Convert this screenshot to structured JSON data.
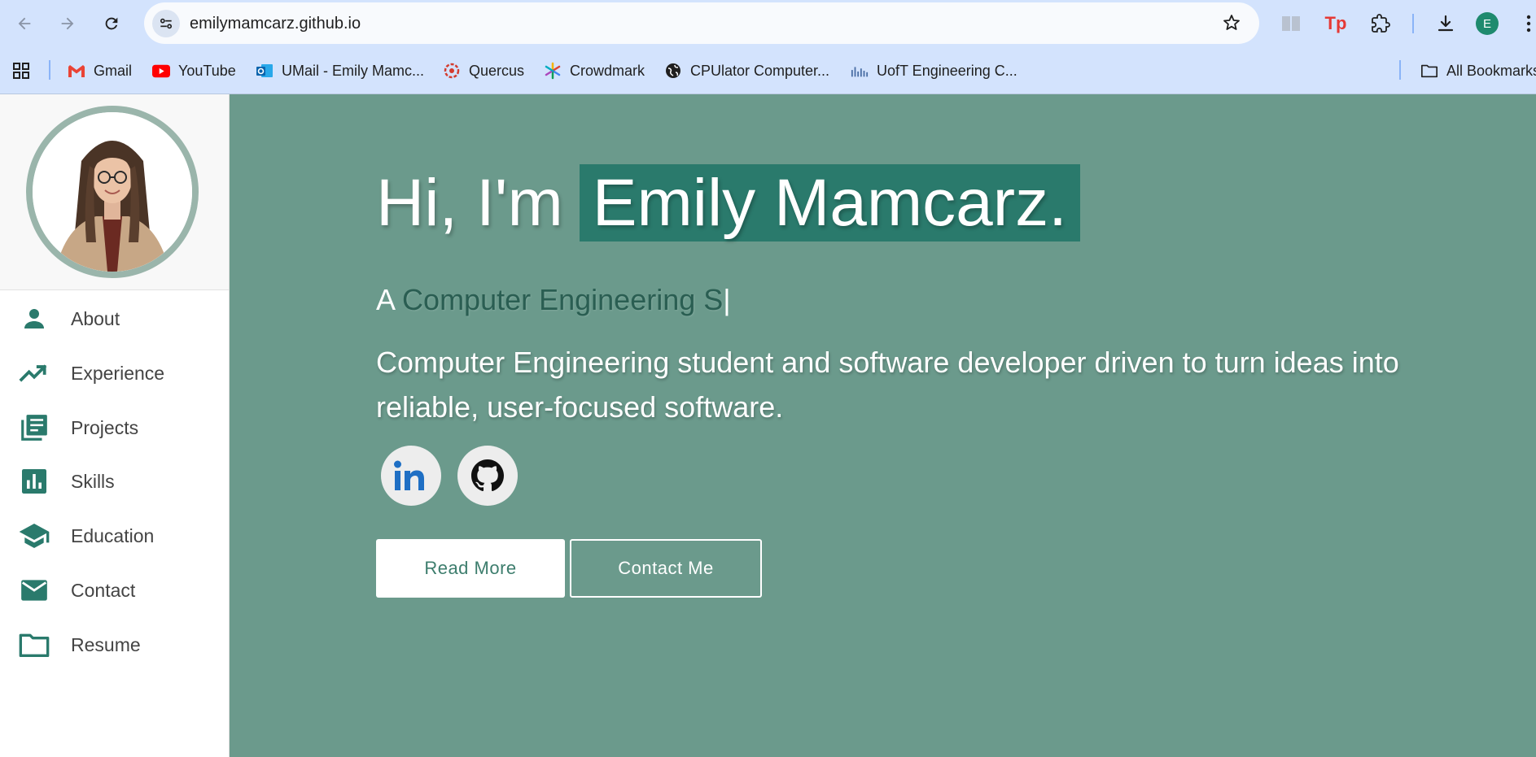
{
  "browser": {
    "url": "emilymamcarz.github.io",
    "profile_initial": "E",
    "bookmarks": [
      {
        "label": "Gmail",
        "icon": "gmail-icon"
      },
      {
        "label": "YouTube",
        "icon": "youtube-icon"
      },
      {
        "label": "UMail - Emily Mamc...",
        "icon": "outlook-icon"
      },
      {
        "label": "Quercus",
        "icon": "quercus-icon"
      },
      {
        "label": "Crowdmark",
        "icon": "crowdmark-icon"
      },
      {
        "label": "CPUlator Computer...",
        "icon": "globe-icon"
      },
      {
        "label": "UofT Engineering C...",
        "icon": "uoft-icon"
      }
    ],
    "all_bookmarks": "All Bookmarks"
  },
  "sidebar": {
    "items": [
      {
        "label": "About",
        "icon": "person-icon"
      },
      {
        "label": "Experience",
        "icon": "trending-up-icon"
      },
      {
        "label": "Projects",
        "icon": "library-books-icon"
      },
      {
        "label": "Skills",
        "icon": "bar-chart-icon"
      },
      {
        "label": "Education",
        "icon": "school-icon"
      },
      {
        "label": "Contact",
        "icon": "mail-icon"
      },
      {
        "label": "Resume",
        "icon": "folder-icon"
      }
    ]
  },
  "hero": {
    "greeting": "Hi, I'm",
    "name": "Emily Mamcarz.",
    "subtitle_prefix": "A",
    "subtitle_typed": "Computer Engineering S",
    "caret": "|",
    "description": "Computer Engineering student and software developer driven to turn ideas into reliable, user-focused software.",
    "read_more": "Read More",
    "contact_me": "Contact Me"
  },
  "colors": {
    "hero_bg": "#6b9a8c",
    "accent": "#2a7a6c",
    "chrome": "#d3e3fd"
  }
}
